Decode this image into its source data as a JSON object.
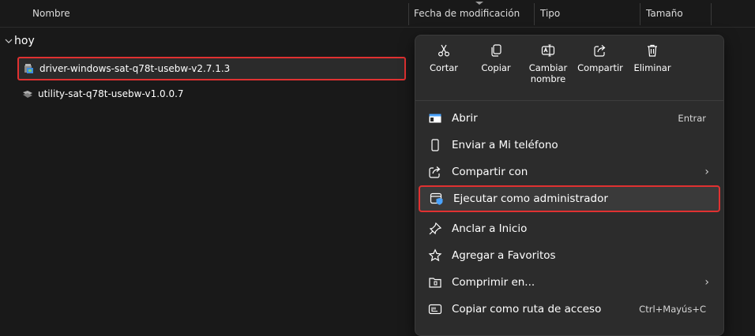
{
  "columns": {
    "name": "Nombre",
    "modified": "Fecha de modificación",
    "type": "Tipo",
    "size": "Tamaño"
  },
  "group": {
    "label": "hoy"
  },
  "files": [
    {
      "name": "driver-windows-sat-q78t-usebw-v2.7.1.3",
      "selected": true
    },
    {
      "name": "utility-sat-q78t-usebw-v1.0.0.7",
      "selected": false
    }
  ],
  "context_menu": {
    "toolbar": [
      {
        "icon": "scissors-icon",
        "label": "Cortar"
      },
      {
        "icon": "copy-icon",
        "label": "Copiar"
      },
      {
        "icon": "rename-icon",
        "label": "Cambiar nombre"
      },
      {
        "icon": "share-icon",
        "label": "Compartir"
      },
      {
        "icon": "trash-icon",
        "label": "Eliminar"
      }
    ],
    "items": [
      {
        "icon": "open-icon",
        "label": "Abrir",
        "shortcut": "Entrar"
      },
      {
        "icon": "phone-icon",
        "label": "Enviar a Mi teléfono"
      },
      {
        "icon": "share-icon",
        "label": "Compartir con",
        "submenu": true
      },
      {
        "icon": "admin-shield-icon",
        "label": "Ejecutar como administrador",
        "highlighted": true
      },
      {
        "icon": "pin-icon",
        "label": "Anclar a Inicio"
      },
      {
        "icon": "star-icon",
        "label": "Agregar a Favoritos"
      },
      {
        "icon": "zip-icon",
        "label": "Comprimir en...",
        "submenu": true
      },
      {
        "icon": "copy-path-icon",
        "label": "Copiar como ruta de acceso",
        "shortcut": "Ctrl+Mayús+C"
      }
    ]
  },
  "colors": {
    "background": "#191919",
    "menu_background": "#2c2c2c",
    "highlight_border": "#e03131",
    "accent_blue": "#4aa3ff"
  }
}
